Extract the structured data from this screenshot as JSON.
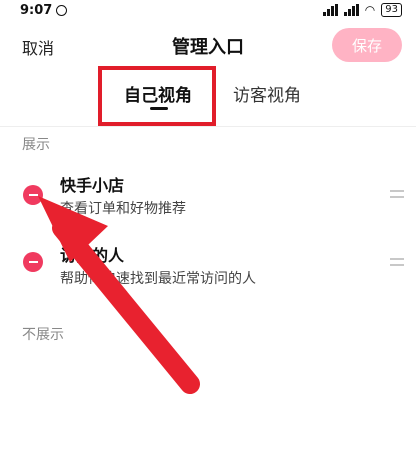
{
  "status_bar": {
    "time": "9:07",
    "battery": "93",
    "icons": [
      "alarm-icon",
      "signal-icon",
      "wifi-icon",
      "battery-icon"
    ]
  },
  "header": {
    "cancel_label": "取消",
    "title": "管理入口",
    "save_label": "保存"
  },
  "tabs": {
    "self_view": "自己视角",
    "visitor_view": "访客视角",
    "active": "self_view"
  },
  "sections": {
    "shown_label": "展示",
    "hidden_label": "不展示"
  },
  "shown_items": [
    {
      "title": "快手小店",
      "desc": "查看订单和好物推荐"
    },
    {
      "title": "访问的人",
      "desc": "帮助你快速找到最近常访问的人"
    }
  ],
  "colors": {
    "accent": "#f03a5f",
    "save_disabled": "#ffb3c4",
    "highlight_box": "#e11d2a",
    "arrow": "#e8222f"
  }
}
